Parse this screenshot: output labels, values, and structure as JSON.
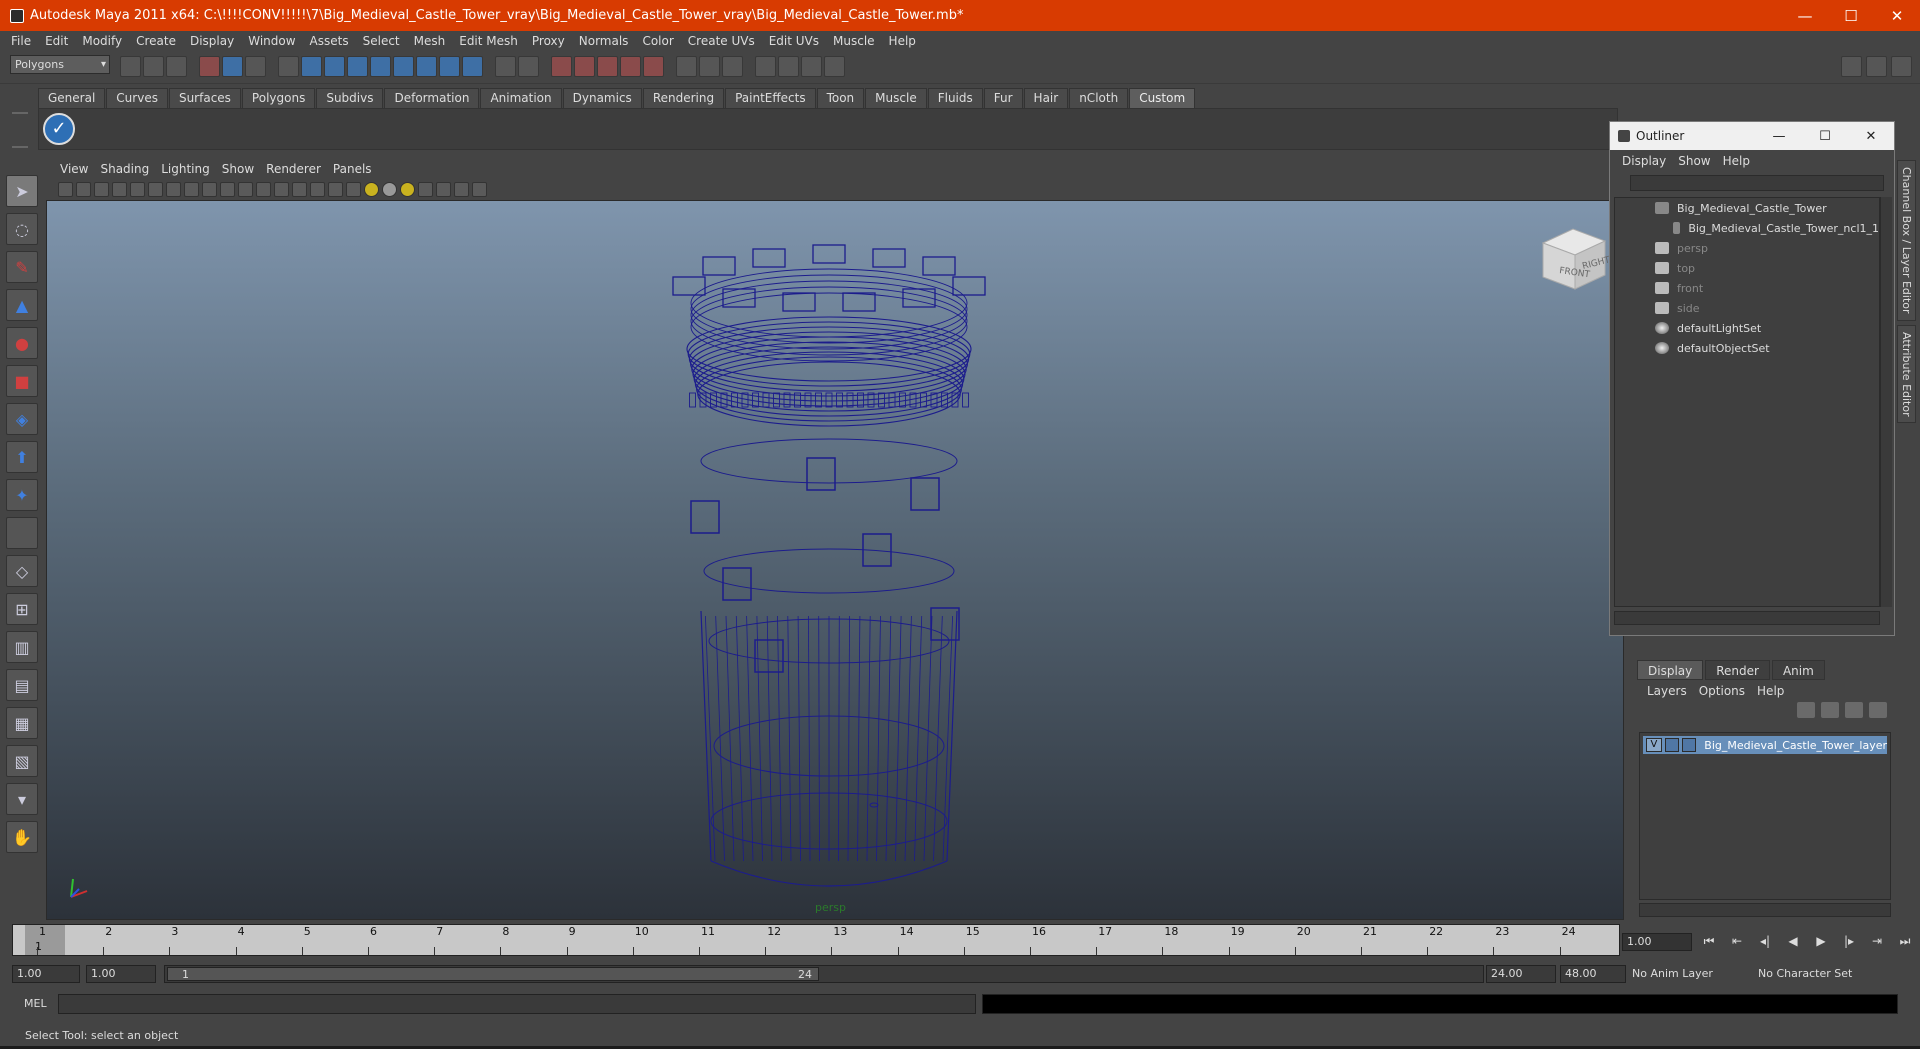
{
  "window": {
    "title": "Autodesk Maya 2011 x64: C:\\!!!!CONV!!!!!\\7\\Big_Medieval_Castle_Tower_vray\\Big_Medieval_Castle_Tower_vray\\Big_Medieval_Castle_Tower.mb*",
    "minimize": "—",
    "maximize": "☐",
    "close": "✕"
  },
  "menubar": [
    "File",
    "Edit",
    "Modify",
    "Create",
    "Display",
    "Window",
    "Assets",
    "Select",
    "Mesh",
    "Edit Mesh",
    "Proxy",
    "Normals",
    "Color",
    "Create UVs",
    "Edit UVs",
    "Muscle",
    "Help"
  ],
  "statusline": {
    "mode": "Polygons"
  },
  "shelf": {
    "tabs": [
      "General",
      "Curves",
      "Surfaces",
      "Polygons",
      "Subdivs",
      "Deformation",
      "Animation",
      "Dynamics",
      "Rendering",
      "PaintEffects",
      "Toon",
      "Muscle",
      "Fluids",
      "Fur",
      "Hair",
      "nCloth",
      "Custom"
    ],
    "active_tab": "Custom"
  },
  "viewport": {
    "menu": [
      "View",
      "Shading",
      "Lighting",
      "Show",
      "Renderer",
      "Panels"
    ],
    "camera": "persp",
    "viewcube": {
      "front": "FRONT",
      "right": "RIGHT"
    },
    "wire_color": "#1c1c8c"
  },
  "outliner": {
    "title": "Outliner",
    "menu": [
      "Display",
      "Show",
      "Help"
    ],
    "items": [
      {
        "label": "Big_Medieval_Castle_Tower",
        "icon": "mesh-icon",
        "dim": false
      },
      {
        "label": "Big_Medieval_Castle_Tower_ncl1_1",
        "icon": "mesh-icon",
        "dim": false
      },
      {
        "label": "persp",
        "icon": "camera-icon",
        "dim": true
      },
      {
        "label": "top",
        "icon": "camera-icon",
        "dim": true
      },
      {
        "label": "front",
        "icon": "camera-icon",
        "dim": true
      },
      {
        "label": "side",
        "icon": "camera-icon",
        "dim": true
      },
      {
        "label": "defaultLightSet",
        "icon": "set-icon",
        "dim": false
      },
      {
        "label": "defaultObjectSet",
        "icon": "set-icon",
        "dim": false
      }
    ]
  },
  "side_tabs": [
    "Channel Box / Layer Editor",
    "Attribute Editor"
  ],
  "layer_editor": {
    "tabs": [
      "Display",
      "Render",
      "Anim"
    ],
    "menu": [
      "Layers",
      "Options",
      "Help"
    ],
    "layer": {
      "visible": "V",
      "name": "Big_Medieval_Castle_Tower_layer"
    }
  },
  "timeline": {
    "ticks": [
      "1",
      "2",
      "3",
      "4",
      "5",
      "6",
      "7",
      "8",
      "9",
      "10",
      "11",
      "12",
      "13",
      "14",
      "15",
      "16",
      "17",
      "18",
      "19",
      "20",
      "21",
      "22",
      "23",
      "24"
    ],
    "current_frame_marker": "1",
    "current_frame": "1.00"
  },
  "range": {
    "start_time": "1.00",
    "playback_start": "1.00",
    "handle_start": "1",
    "handle_end": "24",
    "playback_end": "24.00",
    "end_time": "48.00",
    "anim_layer": "No Anim Layer",
    "character_set": "No Character Set"
  },
  "commandline": {
    "label": "MEL"
  },
  "helpline": {
    "text": "Select Tool: select an object"
  }
}
